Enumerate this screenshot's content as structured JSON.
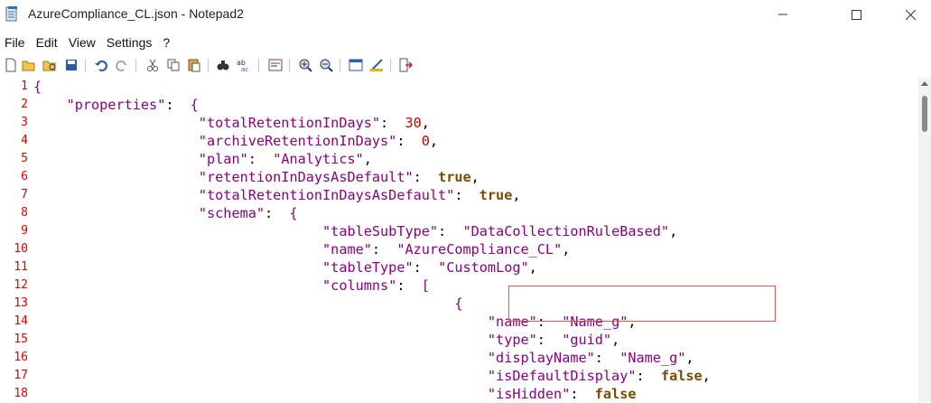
{
  "window": {
    "title": "AzureCompliance_CL.json - Notepad2"
  },
  "menu": [
    "File",
    "Edit",
    "View",
    "Settings",
    "?"
  ],
  "toolbar_icons": [
    "new-file-icon",
    "open-file-icon",
    "browse-icon",
    "save-icon",
    "undo-icon",
    "redo-icon",
    "cut-icon",
    "copy-icon",
    "paste-icon",
    "find-icon",
    "replace-icon",
    "word-wrap-icon",
    "zoom-in-icon",
    "zoom-out-icon",
    "scheme-icon",
    "customize-icon",
    "exit-icon"
  ],
  "colors": {
    "line_number": "#e00000",
    "string": "#8b0080",
    "number": "#c00000",
    "boolean": "#7a4b00",
    "highlight_border": "#e05a5a"
  },
  "lines": [
    {
      "n": "1",
      "t": "{"
    },
    {
      "n": "2",
      "t": "    \"properties\":  {"
    },
    {
      "n": "3",
      "t": "                    \"totalRetentionInDays\":  30,"
    },
    {
      "n": "4",
      "t": "                    \"archiveRetentionInDays\":  0,"
    },
    {
      "n": "5",
      "t": "                    \"plan\":  \"Analytics\","
    },
    {
      "n": "6",
      "t": "                    \"retentionInDaysAsDefault\":  true,"
    },
    {
      "n": "7",
      "t": "                    \"totalRetentionInDaysAsDefault\":  true,"
    },
    {
      "n": "8",
      "t": "                    \"schema\":  {"
    },
    {
      "n": "9",
      "t": "                                   \"tableSubType\":  \"DataCollectionRuleBased\","
    },
    {
      "n": "10",
      "t": "                                   \"name\":  \"AzureCompliance_CL\","
    },
    {
      "n": "11",
      "t": "                                   \"tableType\":  \"CustomLog\","
    },
    {
      "n": "12",
      "t": "                                   \"columns\":  ["
    },
    {
      "n": "13",
      "t": "                                                   {"
    },
    {
      "n": "14",
      "t": "                                                       \"name\":  \"Name_g\","
    },
    {
      "n": "15",
      "t": "                                                       \"type\":  \"guid\","
    },
    {
      "n": "16",
      "t": "                                                       \"displayName\":  \"Name_g\","
    },
    {
      "n": "17",
      "t": "                                                       \"isDefaultDisplay\":  false,"
    },
    {
      "n": "18",
      "t": "                                                       \"isHidden\":  false"
    }
  ]
}
